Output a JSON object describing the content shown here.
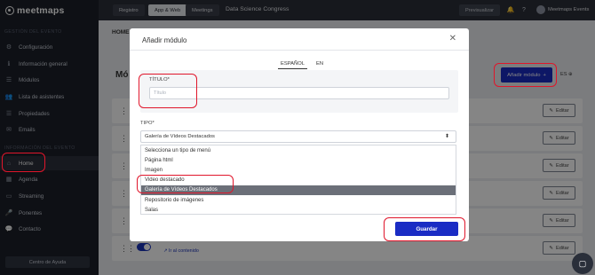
{
  "app": {
    "logo_text": "meetmaps"
  },
  "sidebar": {
    "section_event_mgmt": "GESTIÓN DEL EVENTO",
    "section_event_info": "INFORMACIÓN DEL EVENTO",
    "items": [
      {
        "label": "Configuración",
        "icon": "gear-icon"
      },
      {
        "label": "Información general",
        "icon": "info-icon"
      },
      {
        "label": "Módulos",
        "icon": "list-icon"
      },
      {
        "label": "Lista de asistentes",
        "icon": "users-icon"
      },
      {
        "label": "Propiedades",
        "icon": "list-icon"
      },
      {
        "label": "Emails",
        "icon": "mail-icon"
      },
      {
        "label": "Home",
        "icon": "home-icon"
      },
      {
        "label": "Agenda",
        "icon": "calendar-icon"
      },
      {
        "label": "Streaming",
        "icon": "screen-icon"
      },
      {
        "label": "Ponentes",
        "icon": "mic-icon"
      },
      {
        "label": "Contacto",
        "icon": "chat-icon"
      }
    ],
    "help_label": "Centro de Ayuda"
  },
  "topbar": {
    "tabs": [
      "Registro",
      "App & Web",
      "Meetings"
    ],
    "active_tab": "App & Web",
    "event_name": "Data Science Congress",
    "preview_label": "Previsualizar",
    "user_name": "Meetmaps Events"
  },
  "main": {
    "home_tab": "HOME",
    "modules_title": "Mó",
    "add_module_label": "Añadir módulo",
    "lang_selector": "ES",
    "edit_label": "Editar",
    "content_link": "Ir al contenido"
  },
  "modal": {
    "title": "Añadir módulo",
    "lang_tabs": [
      "ESPAÑOL",
      "EN"
    ],
    "title_label": "TÍTULO*",
    "title_placeholder": "Título",
    "type_label": "TIPO*",
    "type_selected": "Galería de Vídeos Destacados",
    "type_options": [
      "Selecciona un tipo de menú",
      "Página html",
      "Imagen",
      "Video destacado",
      "Galería de Vídeos Destacados",
      "Repositorio de imágenes",
      "Salas"
    ],
    "save_label": "Guardar"
  },
  "colors": {
    "primary": "#1a2cc4",
    "sidebar_bg": "#1c2029",
    "annotation": "#e0162b"
  }
}
